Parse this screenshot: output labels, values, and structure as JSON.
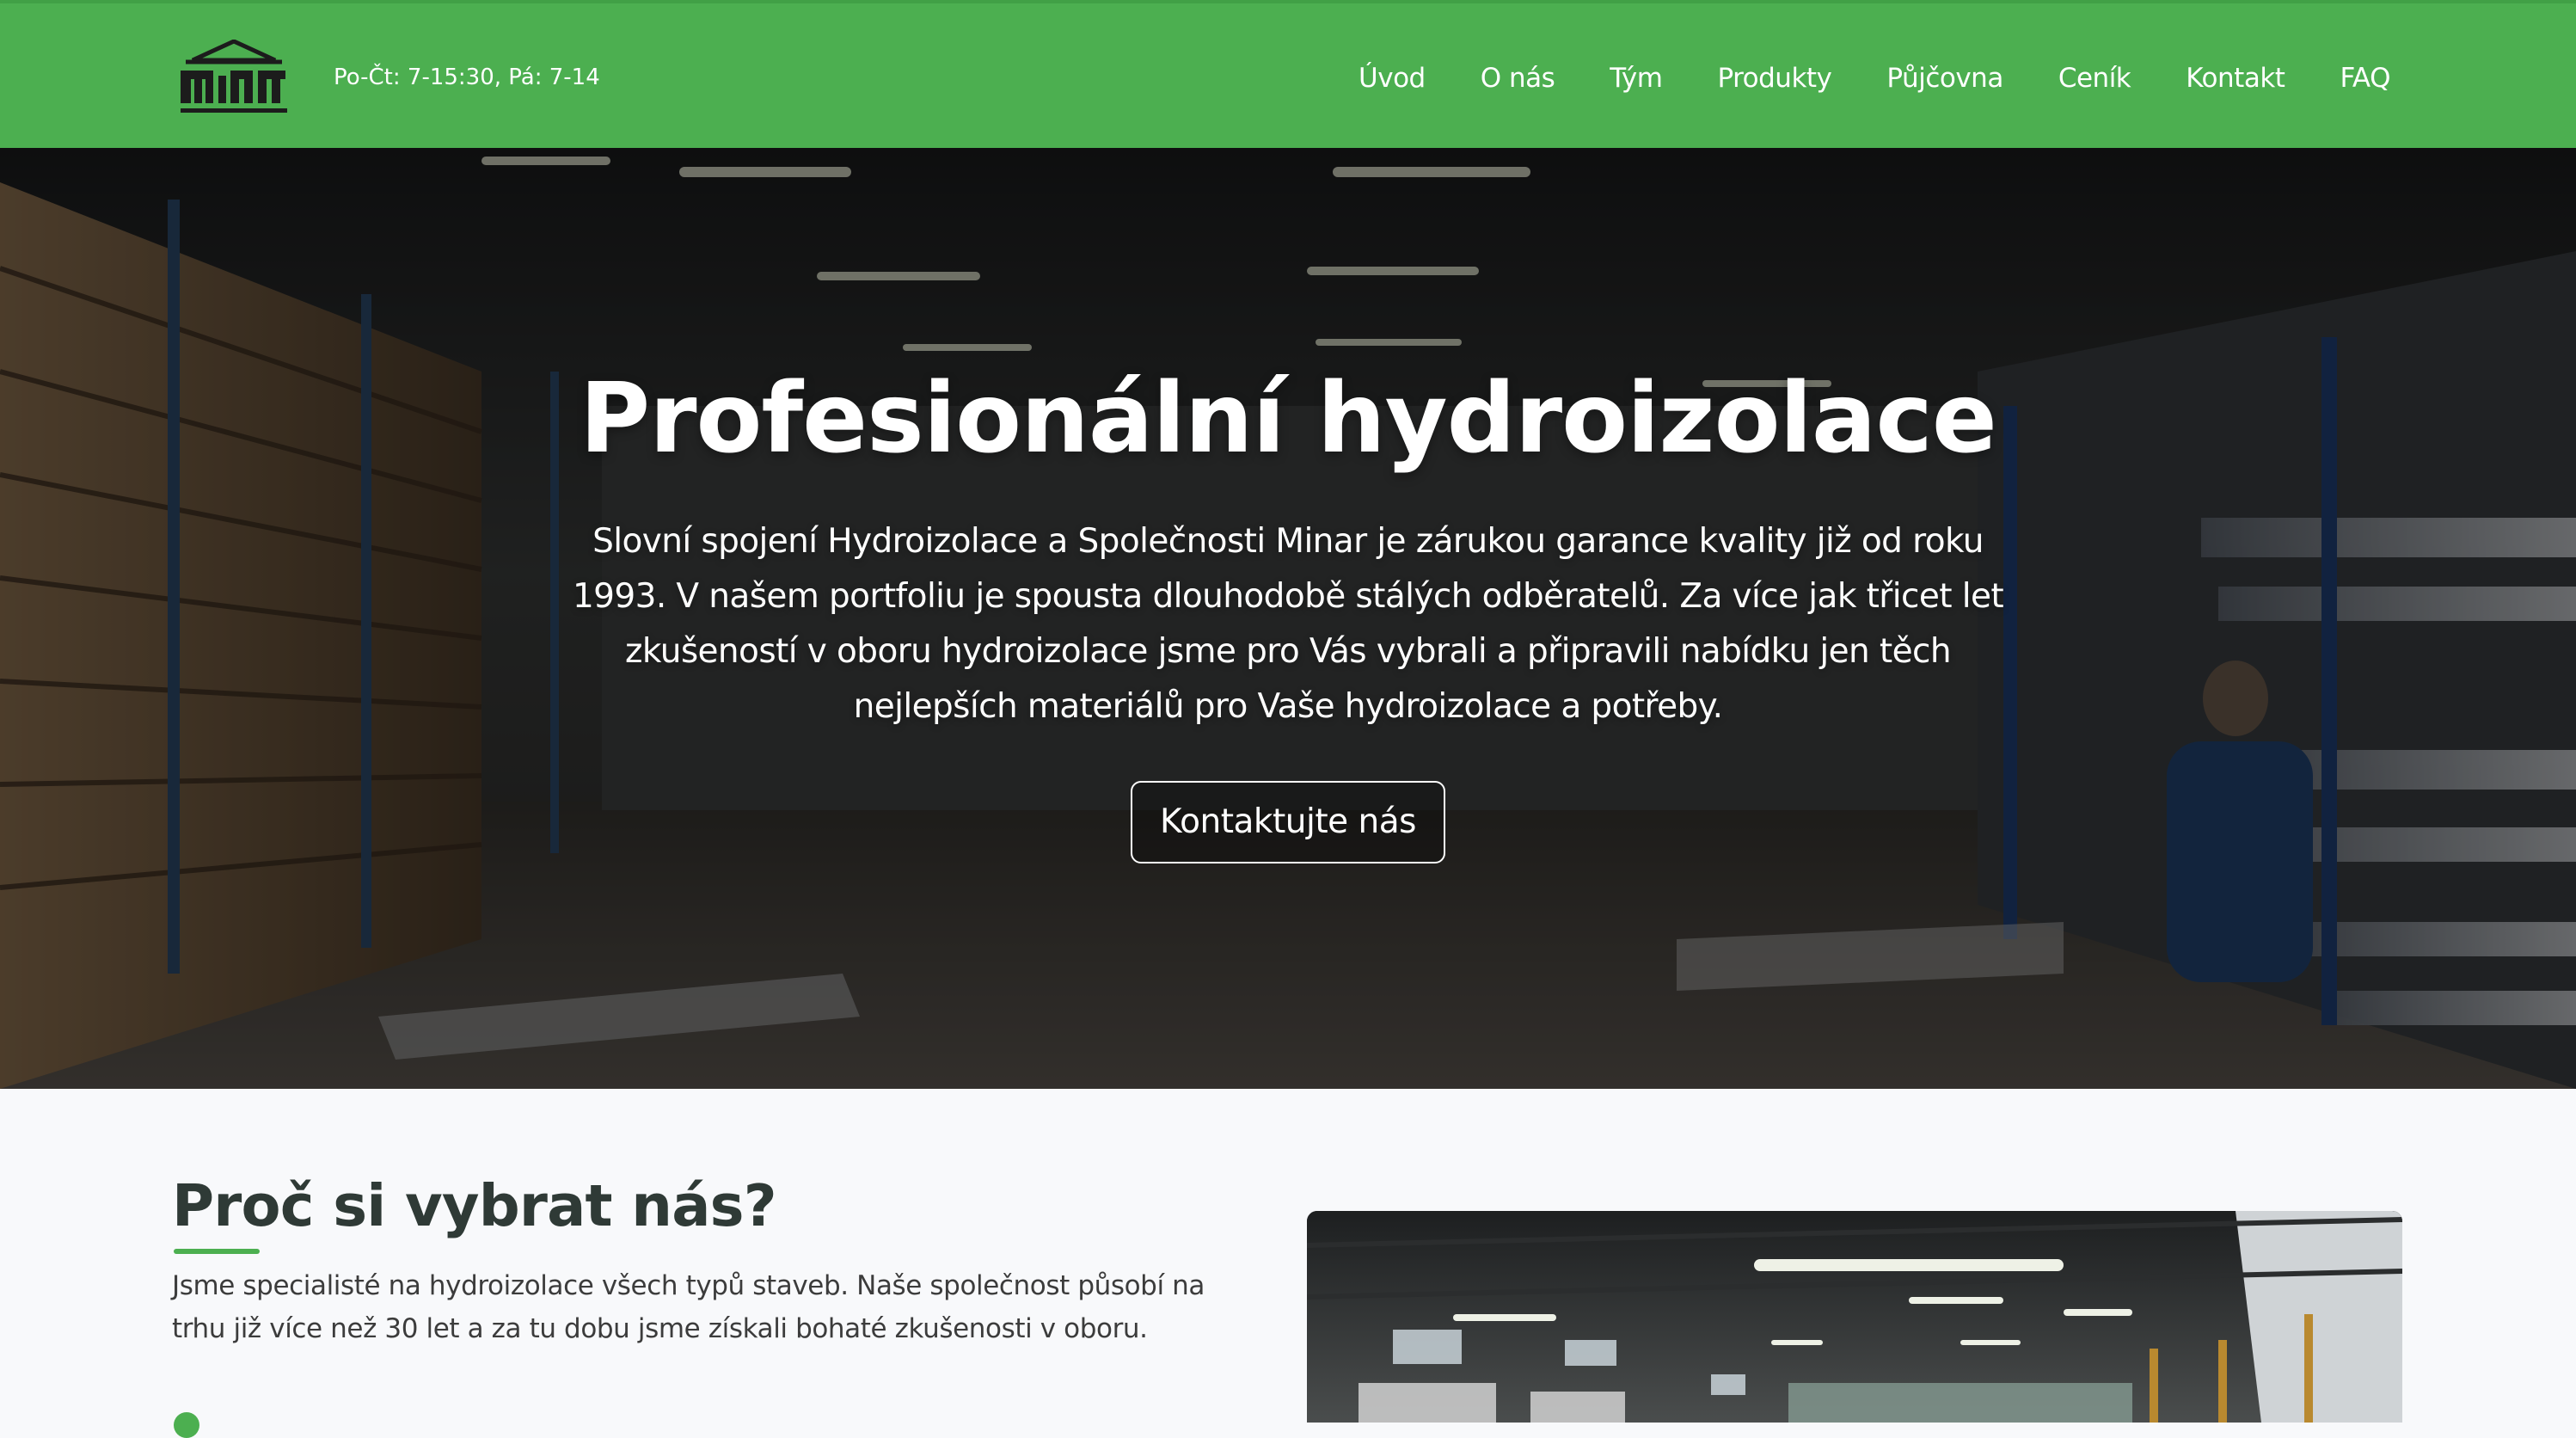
{
  "header": {
    "brand": "MINAR",
    "hours": "Po-Čt: 7-15:30, Pá: 7-14",
    "nav": [
      {
        "label": "Úvod"
      },
      {
        "label": "O nás"
      },
      {
        "label": "Tým"
      },
      {
        "label": "Produkty"
      },
      {
        "label": "Půjčovna"
      },
      {
        "label": "Ceník"
      },
      {
        "label": "Kontakt"
      },
      {
        "label": "FAQ"
      }
    ]
  },
  "hero": {
    "title": "Profesionální hydroizolace",
    "text": "Slovní spojení Hydroizolace a Společnosti Minar je zárukou garance kvality již od roku 1993. V našem portfoliu je spousta dlouhodobě stálých odběratelů. Za více jak třicet let zkušeností v oboru hydroizolace jsme pro Vás vybrali a připravili nabídku jen těch nejlepších materiálů pro Vaše hydroizolace a potřeby.",
    "button": "Kontaktujte nás"
  },
  "why": {
    "title": "Proč si vybrat nás?",
    "text": "Jsme specialisté na hydroizolace všech typů staveb. Naše společnost působí na trhu již více než 30 let a za tu dobu jsme získali bohaté zkušenosti v oboru."
  },
  "colors": {
    "brand_green": "#4caf50",
    "heading_dark": "#2f3a36",
    "page_bg": "#f8f9fb"
  }
}
